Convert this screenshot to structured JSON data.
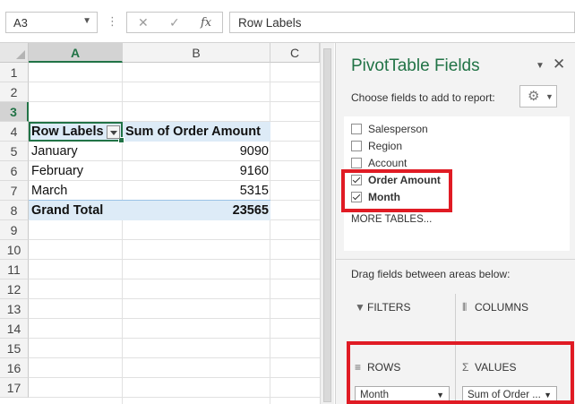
{
  "formula_bar": {
    "name_box": "A3",
    "more": "⋮",
    "cancel": "✕",
    "enter": "✓",
    "fx": "fx",
    "formula": "Row Labels"
  },
  "columns": [
    "A",
    "B",
    "C"
  ],
  "rows": [
    "1",
    "2",
    "3",
    "4",
    "5",
    "6",
    "7",
    "8",
    "9",
    "10",
    "11",
    "12",
    "13",
    "14",
    "15",
    "16",
    "17"
  ],
  "pivot": {
    "header": {
      "label": "Row Labels",
      "value": "Sum of Order Amount"
    },
    "items": [
      {
        "label": "January",
        "value": "9090"
      },
      {
        "label": "February",
        "value": "9160"
      },
      {
        "label": "March",
        "value": "5315"
      }
    ],
    "total": {
      "label": "Grand Total",
      "value": "23565"
    }
  },
  "panel": {
    "title": "PivotTable Fields",
    "close": "✕",
    "caret": "▼",
    "choose_label": "Choose fields to add to report:",
    "gear": "⚙",
    "fields": [
      {
        "label": "Salesperson",
        "checked": false
      },
      {
        "label": "Region",
        "checked": false
      },
      {
        "label": "Account",
        "checked": false
      },
      {
        "label": "Order Amount",
        "checked": true
      },
      {
        "label": "Month",
        "checked": true
      }
    ],
    "more_tables": "MORE TABLES...",
    "drag_label": "Drag fields between areas below:",
    "areas": {
      "filters": {
        "label": "FILTERS",
        "icon": "filter-icon"
      },
      "columns": {
        "label": "COLUMNS",
        "icon": "columns-icon"
      },
      "rows": {
        "label": "ROWS",
        "icon": "rows-icon",
        "item": "Month"
      },
      "values": {
        "label": "VALUES",
        "icon": "sigma-icon",
        "item": "Sum of Order ..."
      }
    },
    "highlight_color": "#e01b24"
  },
  "colors": {
    "accent": "#217346",
    "pivot_band": "#ddebf7"
  }
}
